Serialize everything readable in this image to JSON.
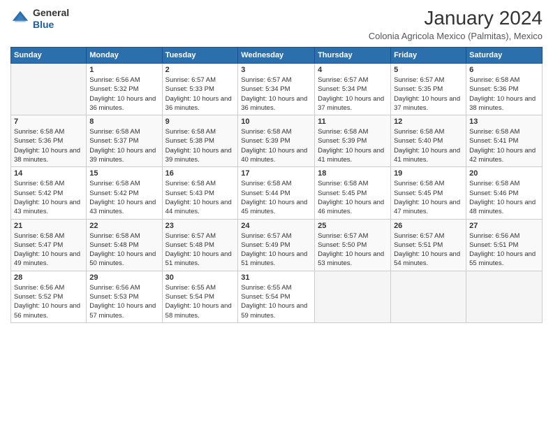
{
  "header": {
    "logo_general": "General",
    "logo_blue": "Blue",
    "month_title": "January 2024",
    "subtitle": "Colonia Agricola Mexico (Palmitas), Mexico"
  },
  "days_of_week": [
    "Sunday",
    "Monday",
    "Tuesday",
    "Wednesday",
    "Thursday",
    "Friday",
    "Saturday"
  ],
  "weeks": [
    [
      {
        "day": "",
        "sunrise": "",
        "sunset": "",
        "daylight": ""
      },
      {
        "day": "1",
        "sunrise": "Sunrise: 6:56 AM",
        "sunset": "Sunset: 5:32 PM",
        "daylight": "Daylight: 10 hours and 36 minutes."
      },
      {
        "day": "2",
        "sunrise": "Sunrise: 6:57 AM",
        "sunset": "Sunset: 5:33 PM",
        "daylight": "Daylight: 10 hours and 36 minutes."
      },
      {
        "day": "3",
        "sunrise": "Sunrise: 6:57 AM",
        "sunset": "Sunset: 5:34 PM",
        "daylight": "Daylight: 10 hours and 36 minutes."
      },
      {
        "day": "4",
        "sunrise": "Sunrise: 6:57 AM",
        "sunset": "Sunset: 5:34 PM",
        "daylight": "Daylight: 10 hours and 37 minutes."
      },
      {
        "day": "5",
        "sunrise": "Sunrise: 6:57 AM",
        "sunset": "Sunset: 5:35 PM",
        "daylight": "Daylight: 10 hours and 37 minutes."
      },
      {
        "day": "6",
        "sunrise": "Sunrise: 6:58 AM",
        "sunset": "Sunset: 5:36 PM",
        "daylight": "Daylight: 10 hours and 38 minutes."
      }
    ],
    [
      {
        "day": "7",
        "sunrise": "Sunrise: 6:58 AM",
        "sunset": "Sunset: 5:36 PM",
        "daylight": "Daylight: 10 hours and 38 minutes."
      },
      {
        "day": "8",
        "sunrise": "Sunrise: 6:58 AM",
        "sunset": "Sunset: 5:37 PM",
        "daylight": "Daylight: 10 hours and 39 minutes."
      },
      {
        "day": "9",
        "sunrise": "Sunrise: 6:58 AM",
        "sunset": "Sunset: 5:38 PM",
        "daylight": "Daylight: 10 hours and 39 minutes."
      },
      {
        "day": "10",
        "sunrise": "Sunrise: 6:58 AM",
        "sunset": "Sunset: 5:39 PM",
        "daylight": "Daylight: 10 hours and 40 minutes."
      },
      {
        "day": "11",
        "sunrise": "Sunrise: 6:58 AM",
        "sunset": "Sunset: 5:39 PM",
        "daylight": "Daylight: 10 hours and 41 minutes."
      },
      {
        "day": "12",
        "sunrise": "Sunrise: 6:58 AM",
        "sunset": "Sunset: 5:40 PM",
        "daylight": "Daylight: 10 hours and 41 minutes."
      },
      {
        "day": "13",
        "sunrise": "Sunrise: 6:58 AM",
        "sunset": "Sunset: 5:41 PM",
        "daylight": "Daylight: 10 hours and 42 minutes."
      }
    ],
    [
      {
        "day": "14",
        "sunrise": "Sunrise: 6:58 AM",
        "sunset": "Sunset: 5:42 PM",
        "daylight": "Daylight: 10 hours and 43 minutes."
      },
      {
        "day": "15",
        "sunrise": "Sunrise: 6:58 AM",
        "sunset": "Sunset: 5:42 PM",
        "daylight": "Daylight: 10 hours and 43 minutes."
      },
      {
        "day": "16",
        "sunrise": "Sunrise: 6:58 AM",
        "sunset": "Sunset: 5:43 PM",
        "daylight": "Daylight: 10 hours and 44 minutes."
      },
      {
        "day": "17",
        "sunrise": "Sunrise: 6:58 AM",
        "sunset": "Sunset: 5:44 PM",
        "daylight": "Daylight: 10 hours and 45 minutes."
      },
      {
        "day": "18",
        "sunrise": "Sunrise: 6:58 AM",
        "sunset": "Sunset: 5:45 PM",
        "daylight": "Daylight: 10 hours and 46 minutes."
      },
      {
        "day": "19",
        "sunrise": "Sunrise: 6:58 AM",
        "sunset": "Sunset: 5:45 PM",
        "daylight": "Daylight: 10 hours and 47 minutes."
      },
      {
        "day": "20",
        "sunrise": "Sunrise: 6:58 AM",
        "sunset": "Sunset: 5:46 PM",
        "daylight": "Daylight: 10 hours and 48 minutes."
      }
    ],
    [
      {
        "day": "21",
        "sunrise": "Sunrise: 6:58 AM",
        "sunset": "Sunset: 5:47 PM",
        "daylight": "Daylight: 10 hours and 49 minutes."
      },
      {
        "day": "22",
        "sunrise": "Sunrise: 6:58 AM",
        "sunset": "Sunset: 5:48 PM",
        "daylight": "Daylight: 10 hours and 50 minutes."
      },
      {
        "day": "23",
        "sunrise": "Sunrise: 6:57 AM",
        "sunset": "Sunset: 5:48 PM",
        "daylight": "Daylight: 10 hours and 51 minutes."
      },
      {
        "day": "24",
        "sunrise": "Sunrise: 6:57 AM",
        "sunset": "Sunset: 5:49 PM",
        "daylight": "Daylight: 10 hours and 51 minutes."
      },
      {
        "day": "25",
        "sunrise": "Sunrise: 6:57 AM",
        "sunset": "Sunset: 5:50 PM",
        "daylight": "Daylight: 10 hours and 53 minutes."
      },
      {
        "day": "26",
        "sunrise": "Sunrise: 6:57 AM",
        "sunset": "Sunset: 5:51 PM",
        "daylight": "Daylight: 10 hours and 54 minutes."
      },
      {
        "day": "27",
        "sunrise": "Sunrise: 6:56 AM",
        "sunset": "Sunset: 5:51 PM",
        "daylight": "Daylight: 10 hours and 55 minutes."
      }
    ],
    [
      {
        "day": "28",
        "sunrise": "Sunrise: 6:56 AM",
        "sunset": "Sunset: 5:52 PM",
        "daylight": "Daylight: 10 hours and 56 minutes."
      },
      {
        "day": "29",
        "sunrise": "Sunrise: 6:56 AM",
        "sunset": "Sunset: 5:53 PM",
        "daylight": "Daylight: 10 hours and 57 minutes."
      },
      {
        "day": "30",
        "sunrise": "Sunrise: 6:55 AM",
        "sunset": "Sunset: 5:54 PM",
        "daylight": "Daylight: 10 hours and 58 minutes."
      },
      {
        "day": "31",
        "sunrise": "Sunrise: 6:55 AM",
        "sunset": "Sunset: 5:54 PM",
        "daylight": "Daylight: 10 hours and 59 minutes."
      },
      {
        "day": "",
        "sunrise": "",
        "sunset": "",
        "daylight": ""
      },
      {
        "day": "",
        "sunrise": "",
        "sunset": "",
        "daylight": ""
      },
      {
        "day": "",
        "sunrise": "",
        "sunset": "",
        "daylight": ""
      }
    ]
  ]
}
